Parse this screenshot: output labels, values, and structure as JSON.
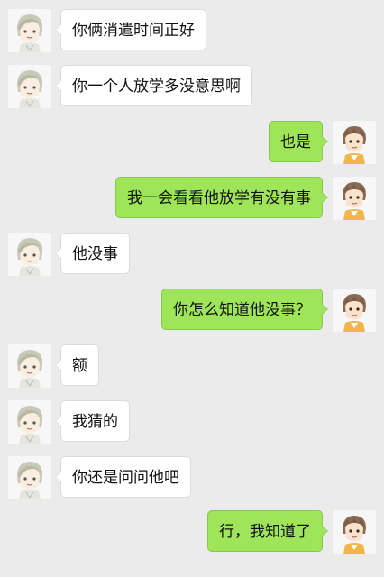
{
  "colors": {
    "background": "#ebebeb",
    "incoming_bubble": "#ffffff",
    "outgoing_bubble": "#9ee55a"
  },
  "avatars": {
    "incoming": "white-haired-boy-avatar",
    "outgoing": "brown-haired-boy-avatar"
  },
  "messages": [
    {
      "side": "left",
      "text": "你俩消遣时间正好"
    },
    {
      "side": "left",
      "text": "你一个人放学多没意思啊"
    },
    {
      "side": "right",
      "text": "也是"
    },
    {
      "side": "right",
      "text": "我一会看看他放学有没有事"
    },
    {
      "side": "left",
      "text": "他没事"
    },
    {
      "side": "right",
      "text": "你怎么知道他没事？"
    },
    {
      "side": "left",
      "text": "额"
    },
    {
      "side": "left",
      "text": "我猜的"
    },
    {
      "side": "left",
      "text": "你还是问问他吧"
    },
    {
      "side": "right",
      "text": "行，我知道了"
    }
  ]
}
